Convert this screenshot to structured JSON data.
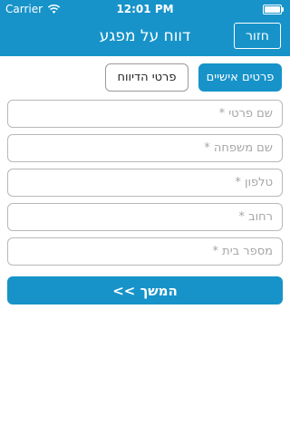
{
  "status_bar": {
    "carrier": "Carrier",
    "time": "12:01 PM",
    "wifi_icon": "wifi-icon",
    "battery_icon": "battery-icon",
    "battery_level": 1.0
  },
  "nav": {
    "title": "דווח על מפגע",
    "back_label": "חזור"
  },
  "tabs": [
    {
      "label": "פרטים אישיים",
      "selected": true
    },
    {
      "label": "פרטי הדיווח",
      "selected": false
    }
  ],
  "form": {
    "fields": [
      {
        "placeholder": "שם פרטי *",
        "value": ""
      },
      {
        "placeholder": "שם משפחה *",
        "value": ""
      },
      {
        "placeholder": "טלפון *",
        "value": ""
      },
      {
        "placeholder": "רחוב *",
        "value": ""
      },
      {
        "placeholder": "מספר בית *",
        "value": ""
      }
    ],
    "continue_label": "המשך >>"
  },
  "colors": {
    "accent": "#1793c9",
    "background": "#ffffff",
    "field_border": "#b8b8b8"
  }
}
